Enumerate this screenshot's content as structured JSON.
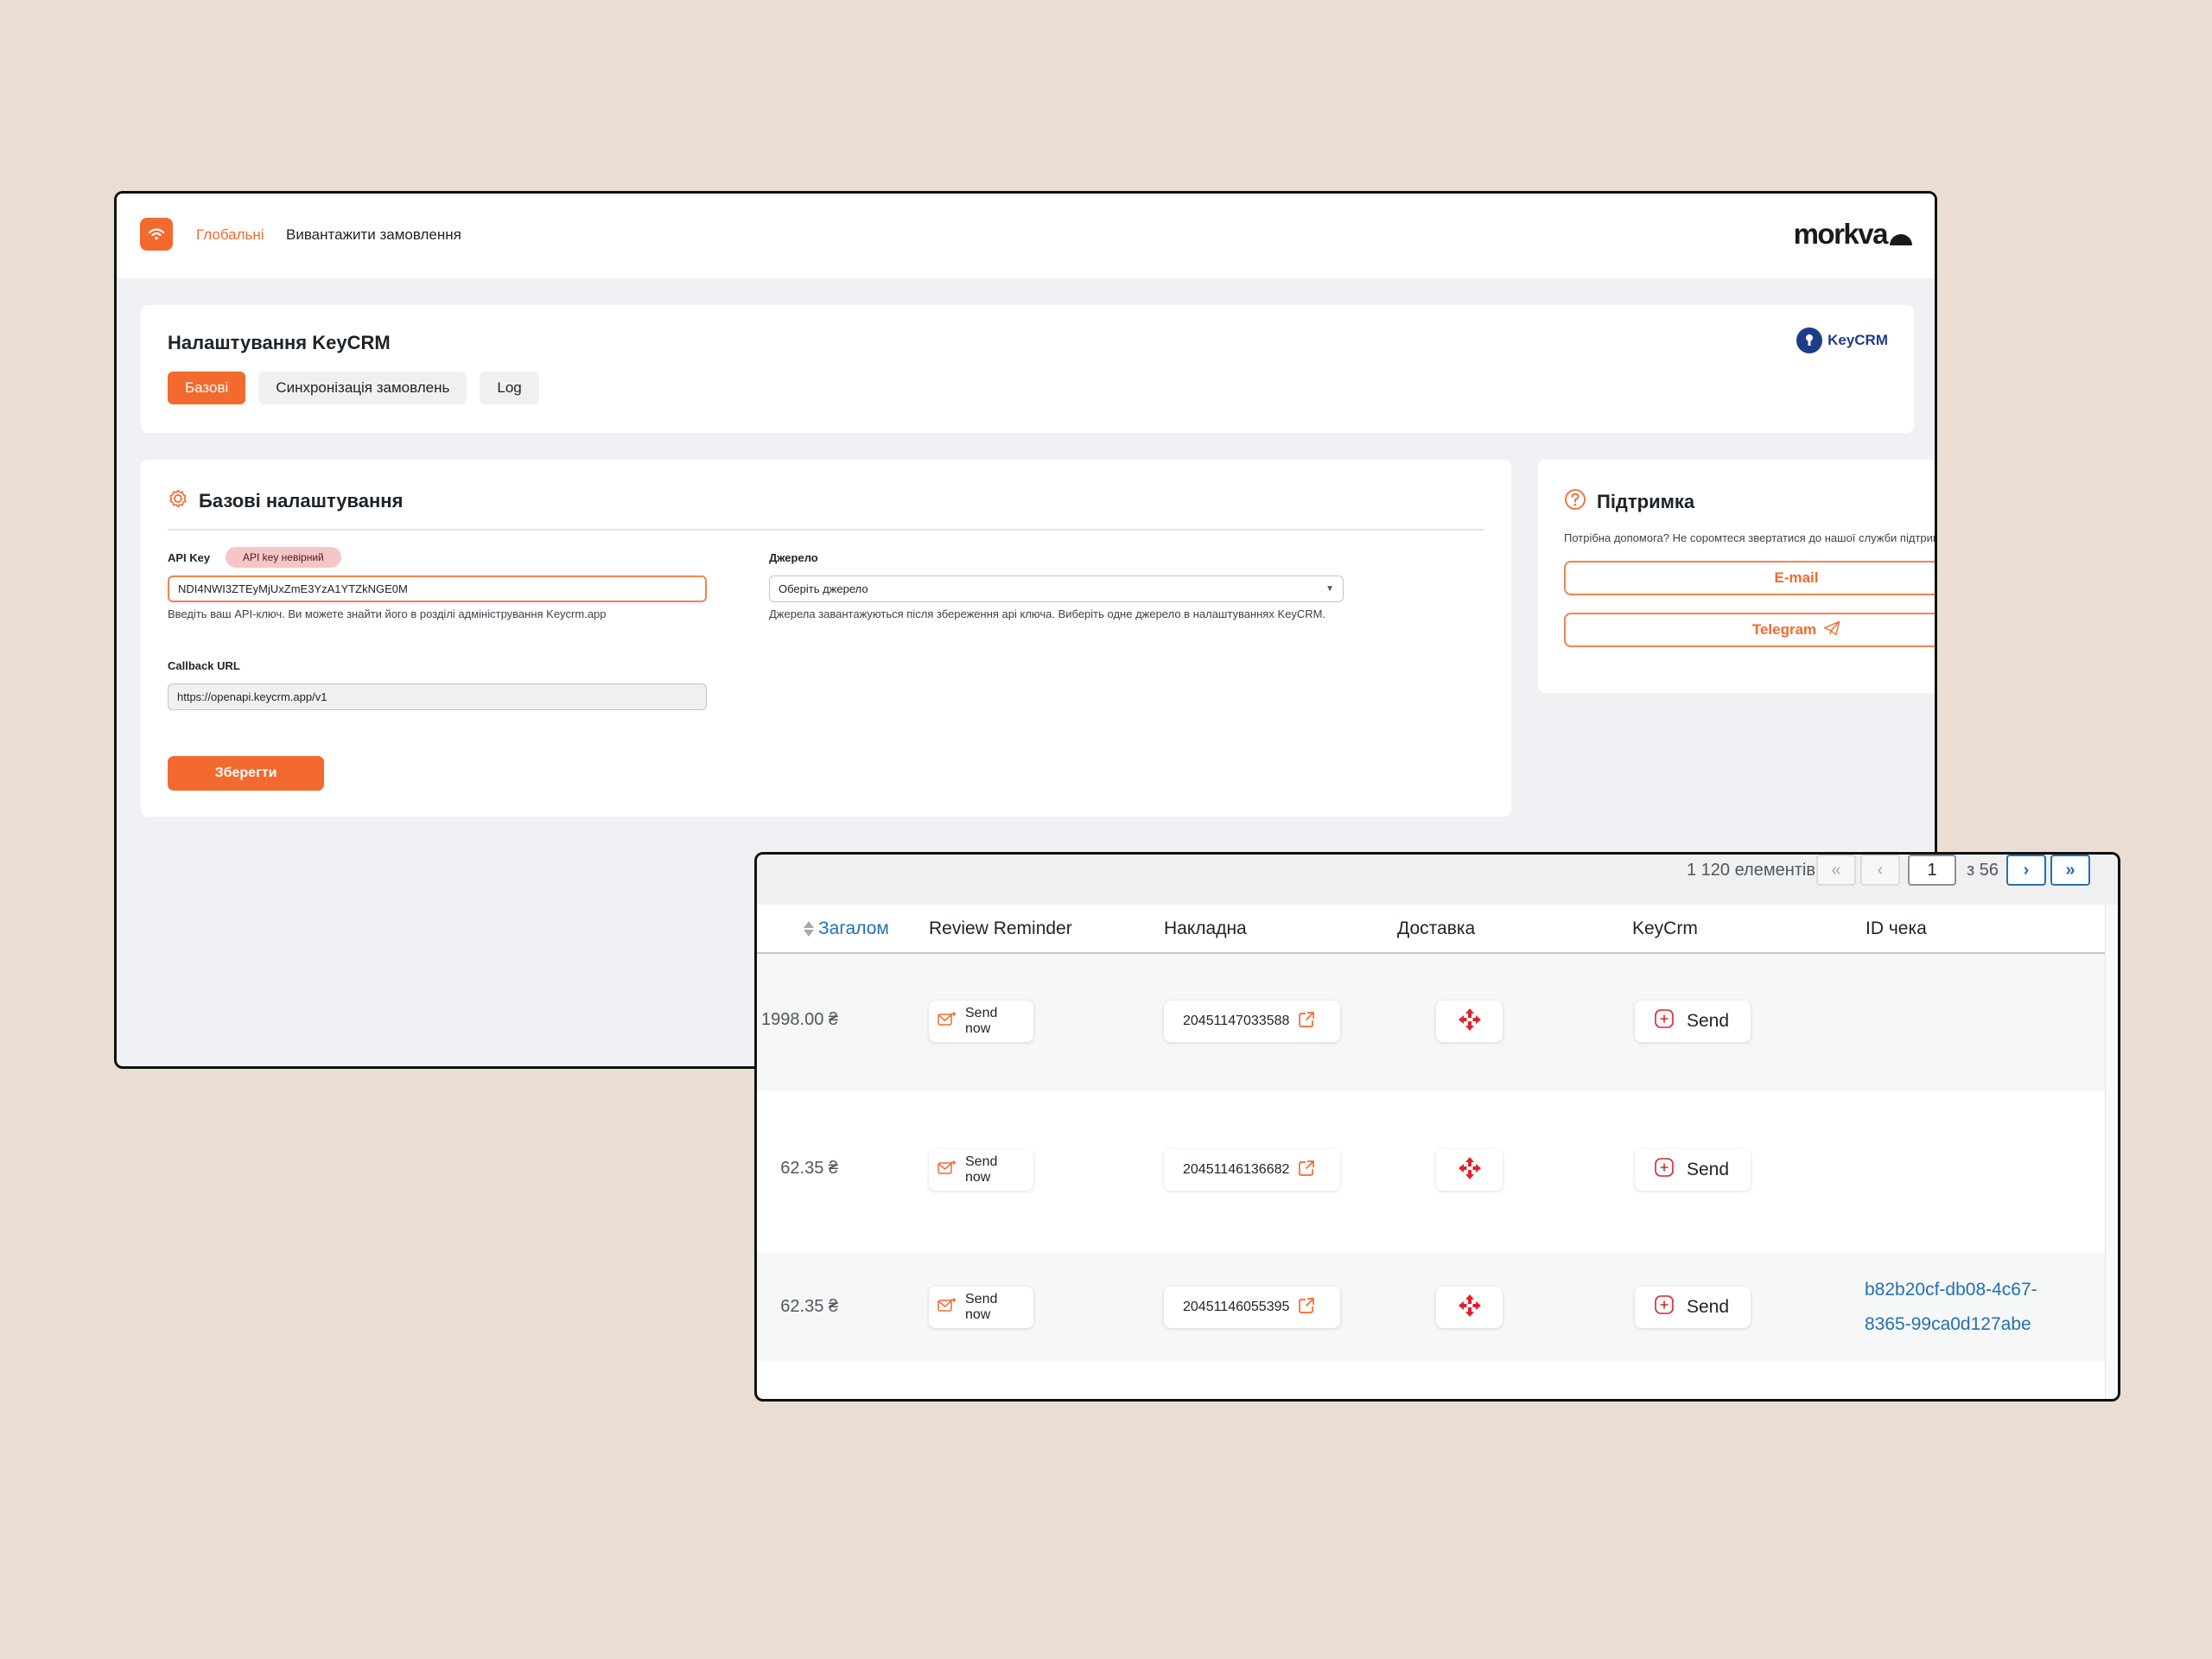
{
  "app": {
    "nav": {
      "active": "Глобальні",
      "item2": "Вивантажити замовлення"
    },
    "brand": "morkva"
  },
  "header": {
    "title": "Налаштування KeyCRM",
    "tabs": [
      "Базові",
      "Синхронізація замовлень",
      "Log"
    ],
    "partner": "KeyCRM"
  },
  "settings": {
    "title": "Базові налаштування",
    "api_key_label": "API Key",
    "api_key_badge": "API key невірний",
    "api_key_value": "NDI4NWI3ZTEyMjUxZmE3YzA1YTZkNGE0M",
    "api_key_hint": "Введіть ваш API-ключ. Ви можете знайти його в розділі адміністрування Keycrm.app",
    "callback_label": "Callback URL",
    "callback_value": "https://openapi.keycrm.app/v1",
    "source_label": "Джерело",
    "source_placeholder": "Оберіть джерело",
    "source_hint": "Джерела завантажуються після збереження api ключа. Виберіть одне джерело в налаштуваннях KeyCRM.",
    "save": "Зберегти"
  },
  "support": {
    "title": "Підтримка",
    "text": "Потрібна допомога? Не соромтеся звертатися до нашої служби підтримки.",
    "email": "E-mail",
    "telegram": "Telegram"
  },
  "orders": {
    "count": "1 120 елементів",
    "pager": {
      "first": "«",
      "prev": "‹",
      "page": "1",
      "of": "з 56",
      "next": "›",
      "last": "»"
    },
    "columns": [
      "Загалом",
      "Review Reminder",
      "Накладна",
      "Доставка",
      "KeyCrm",
      "ID чека"
    ],
    "rows": [
      {
        "total": "1998.00 ₴",
        "reminder": "Send now",
        "ttn": "20451147033588",
        "keycrm": "Send",
        "receipt": ""
      },
      {
        "total": "62.35 ₴",
        "reminder": "Send now",
        "ttn": "20451146136682",
        "keycrm": "Send",
        "receipt": ""
      },
      {
        "total": "62.35 ₴",
        "reminder": "Send now",
        "ttn": "20451146055395",
        "keycrm": "Send",
        "receipt": "b82b20cf-db08-4c67-8365-99ca0d127abe"
      }
    ]
  },
  "colors": {
    "accent": "#f26a2e",
    "link": "#2271b1",
    "keycrm": "#1f3c88",
    "nova_poshta": "#e0212b"
  },
  "icons": [
    "wifi-plug-icon",
    "gear-icon",
    "help-circle-icon",
    "telegram-send-icon",
    "sort-icon",
    "mail-send-icon",
    "external-link-icon",
    "nova-poshta-icon",
    "keycrm-plus-icon"
  ]
}
